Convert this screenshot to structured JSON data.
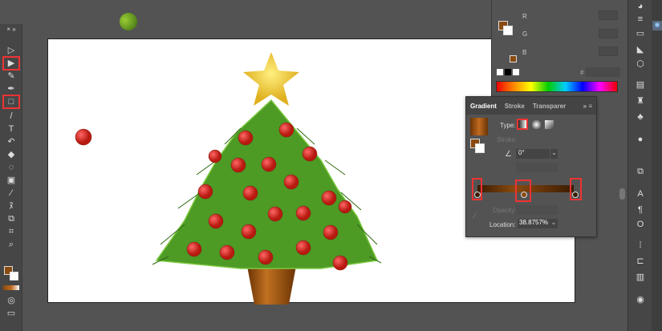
{
  "gradient_panel": {
    "tabs": [
      "Gradient",
      "Stroke",
      "Transparer"
    ],
    "type_label": "Type:",
    "stroke_label": "Stroke:",
    "angle_value": "0°",
    "opacity_label": "Opacity:",
    "location_label": "Location:",
    "location_value": "38.8757%",
    "colors": {
      "stop": "#7a3d06",
      "highlight": "#e33333"
    }
  },
  "color_panel": {
    "channels": [
      "R",
      "G",
      "B"
    ],
    "hex_label": "#"
  },
  "colors": {
    "fill": "#8a4a10",
    "artboard": "#ffffff",
    "ui_bg": "#535353"
  }
}
